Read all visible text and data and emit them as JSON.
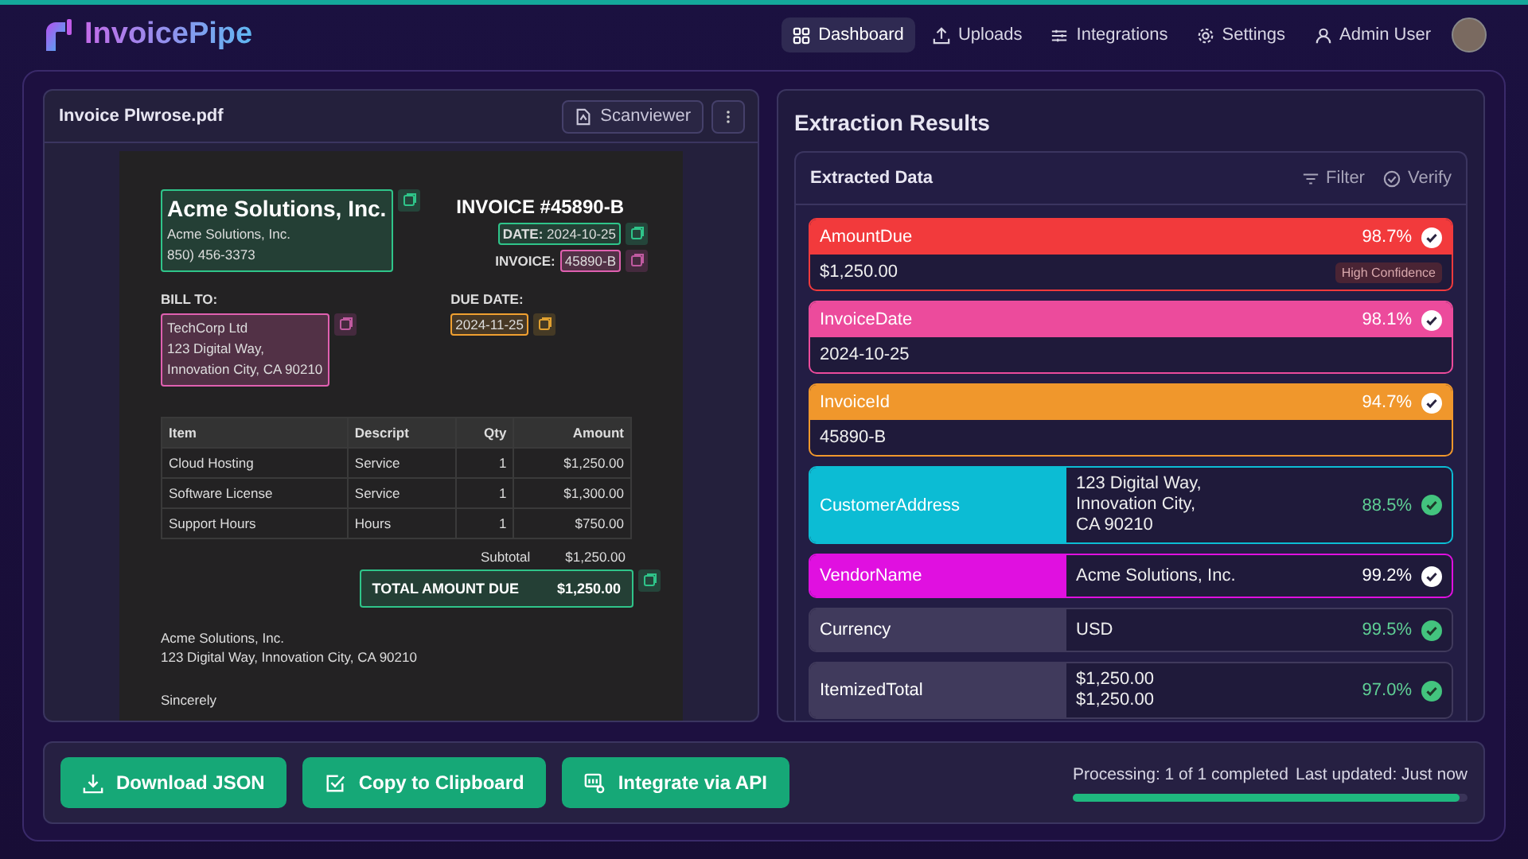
{
  "brand": "InvoicePipe",
  "nav": [
    {
      "label": "Dashboard",
      "selected": true
    },
    {
      "label": "Uploads",
      "selected": false
    },
    {
      "label": "Integrations",
      "selected": false
    },
    {
      "label": "Settings",
      "selected": false
    }
  ],
  "user": {
    "name": "Admin User"
  },
  "viewer": {
    "file_name": "Invoice Plwrose.pdf",
    "scan_button": "Scanviewer"
  },
  "document": {
    "vendor_name": "Acme Solutions, Inc.",
    "vendor_lines": [
      "Acme Solutions, Inc.",
      "850) 456-3373"
    ],
    "title": "INVOICE #45890-B",
    "date_label": "DATE:",
    "date": "2024-10-25",
    "invoice_label": "INVOICE:",
    "invoice_id": "45890-B",
    "bill_to_label": "BILL TO:",
    "bill_to_lines": [
      "TechCorp Ltd",
      "123 Digital Way,",
      "Innovation City, CA 90210"
    ],
    "due_label": "DUE DATE:",
    "due_date": "2024-11-25",
    "columns": [
      "Item",
      "Descript",
      "Qty",
      "Amount"
    ],
    "rows": [
      [
        "Cloud Hosting",
        "Service",
        "1",
        "$1,250.00"
      ],
      [
        "Software License",
        "Service",
        "1",
        "$1,300.00"
      ],
      [
        "Support Hours",
        "Hours",
        "1",
        "$750.00"
      ]
    ],
    "subtotal_label": "Subtotal",
    "subtotal": "$1,250.00",
    "total_label": "TOTAL AMOUNT DUE",
    "total": "$1,250.00",
    "footer_lines": [
      "Acme Solutions, Inc.",
      "123 Digital Way, Innovation City, CA 90210"
    ],
    "closing": "Sincerely"
  },
  "results": {
    "title": "Extraction Results",
    "card_title": "Extracted Data",
    "filter": "Filter",
    "verify": "Verify",
    "fields": [
      {
        "kind": "banner",
        "name": "AmountDue",
        "color": "#f23a3c",
        "confidence": "98.7%",
        "emphasis": true,
        "value": [
          "$1,250.00"
        ],
        "badge": "High Confidence"
      },
      {
        "kind": "banner",
        "name": "InvoiceDate",
        "color": "#ec4b9c",
        "confidence": "98.1%",
        "emphasis": true,
        "value": [
          "2024-10-25"
        ]
      },
      {
        "kind": "banner",
        "name": "InvoiceId",
        "color": "#f0972c",
        "confidence": "94.7%",
        "emphasis": true,
        "value": [
          "45890-B"
        ]
      },
      {
        "kind": "split",
        "name": "CustomerAddress",
        "color": "#0cbcd4",
        "confidence": "88.5%",
        "emphasis": false,
        "value": [
          "123 Digital Way,",
          "Innovation City,",
          "CA 90210"
        ]
      },
      {
        "kind": "split",
        "name": "VendorName",
        "color": "#e010e0",
        "confidence": "99.2%",
        "emphasis": true,
        "value": [
          "Acme Solutions, Inc."
        ]
      },
      {
        "kind": "split",
        "name": "Currency",
        "color": "#403a5c",
        "confidence": "99.5%",
        "emphasis": false,
        "value": [
          "USD"
        ]
      },
      {
        "kind": "split",
        "name": "ItemizedTotal",
        "color": "#403a5c",
        "confidence": "97.0%",
        "emphasis": false,
        "value": [
          "$1,250.00",
          "$1,250.00"
        ]
      }
    ]
  },
  "actions": [
    {
      "label": "Download JSON"
    },
    {
      "label": "Copy to Clipboard"
    },
    {
      "label": "Integrate via API"
    }
  ],
  "status": {
    "processing": "Processing: 1 of 1 completed",
    "updated": "Last updated: Just now",
    "level": 0.98
  }
}
